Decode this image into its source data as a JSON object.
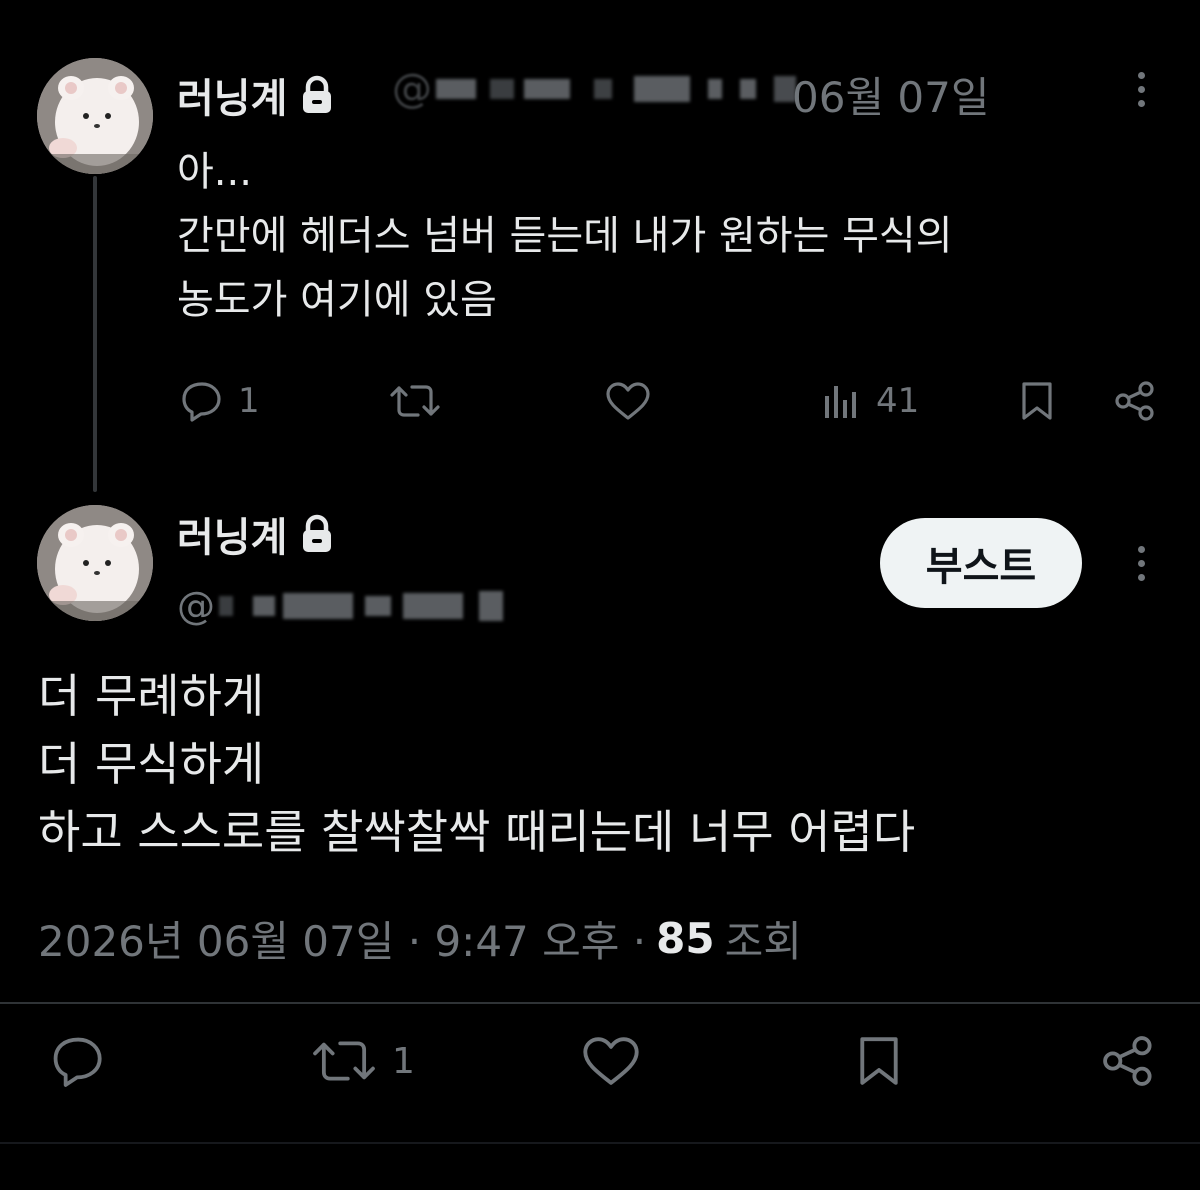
{
  "tweet1": {
    "display_name": "러닝계",
    "handle_prefix": "@",
    "date": "06월 07일",
    "text_lines": [
      "아...",
      "간만에 헤더스 넘버 듣는데 내가 원하는 무식의",
      "농도가 여기에 있음"
    ],
    "actions": {
      "reply_count": "1",
      "repost_count": "",
      "like_count": "",
      "views_count": "41"
    }
  },
  "tweet2": {
    "display_name": "러닝계",
    "handle_prefix": "@",
    "follow_label": "부스트",
    "text_lines": [
      "더 무례하게",
      "더 무식하게",
      "하고 스스로를 찰싹찰싹 때리는데 너무 어렵다"
    ],
    "timestamp": "2026년 06월 07일 · 9:47 오후 ·",
    "views_count": "85",
    "views_label": "조회",
    "actions": {
      "reply_count": "",
      "repost_count": "1",
      "like_count": ""
    }
  },
  "colors": {
    "background": "#000000",
    "text": "#e7e9ea",
    "muted": "#71767b",
    "button_bg": "#eff3f4"
  },
  "icons": [
    "lock-icon",
    "more-icon",
    "reply-icon",
    "repost-icon",
    "like-icon",
    "views-icon",
    "bookmark-icon",
    "share-icon"
  ]
}
